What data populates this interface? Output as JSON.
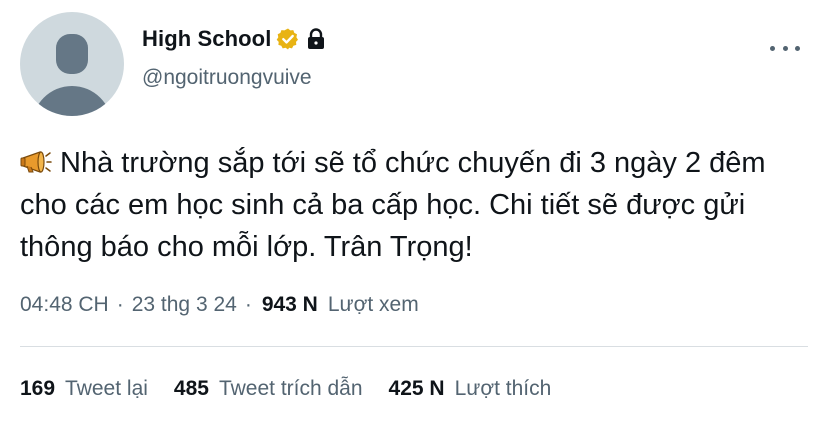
{
  "profile": {
    "display_name": "High School",
    "handle": "@ngoitruongvuive",
    "verified_color": "#e8b314",
    "avatar_bg": "#cfd9de",
    "avatar_fg": "#657786",
    "icons": [
      "verified-badge-icon",
      "lock-icon",
      "more-options-icon"
    ]
  },
  "tweet": {
    "leading_emoji": "megaphone-icon",
    "text": "Nhà trường sắp tới sẽ tổ chức chuyến đi 3 ngày 2 đêm cho các em học sinh cả ba cấp học. Chi tiết sẽ được gửi thông báo cho mỗi lớp. Trân Trọng!"
  },
  "meta": {
    "time": "04:48 CH",
    "separator": "·",
    "date": "23 thg 3 24",
    "views_count": "943 N",
    "views_label": "Lượt xem"
  },
  "stats": [
    {
      "count": "169",
      "label": "Tweet lại"
    },
    {
      "count": "485",
      "label": "Tweet trích dẫn"
    },
    {
      "count": "425 N",
      "label": "Lượt thích"
    }
  ],
  "colors": {
    "text_primary": "#0f1419",
    "text_secondary": "#536471",
    "divider": "#d9dee2"
  }
}
